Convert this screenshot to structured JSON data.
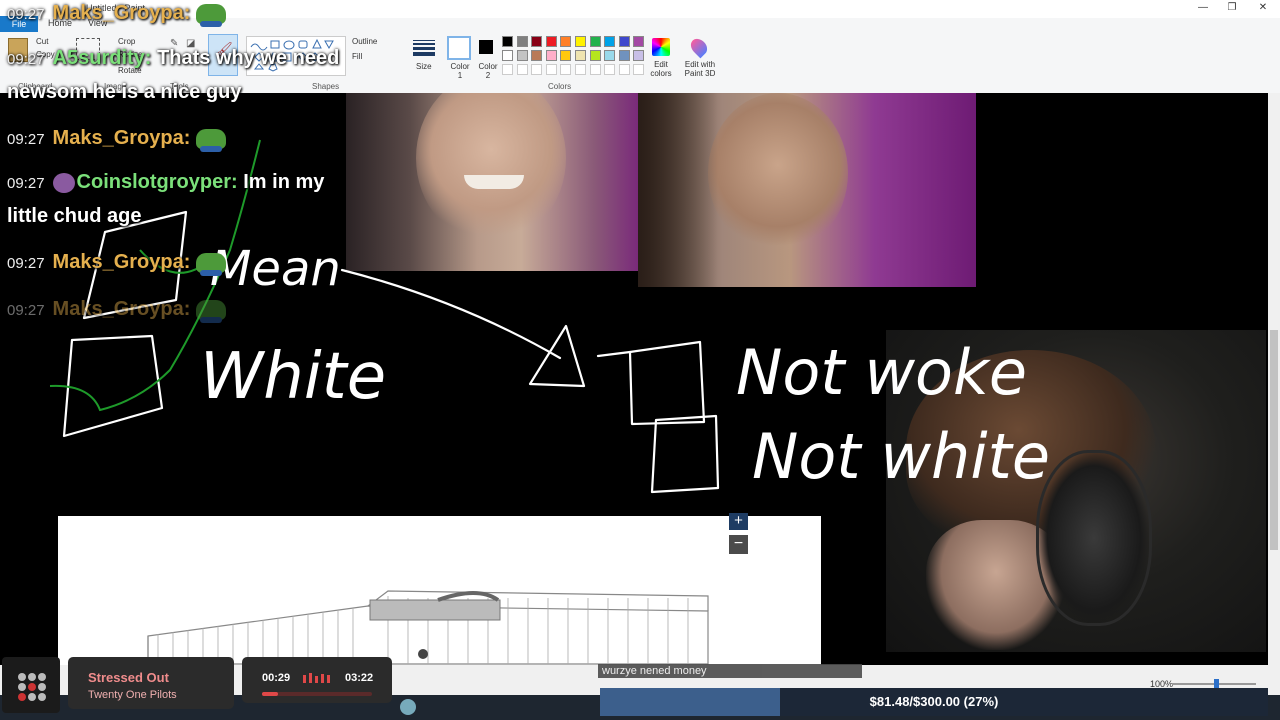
{
  "window": {
    "title": "Untitled - Paint",
    "file_tab": "File",
    "tabs": [
      "Home",
      "View"
    ],
    "controls": [
      "—",
      "❐",
      "✕"
    ]
  },
  "ribbon": {
    "clipboard": {
      "cut": "Cut",
      "copy": "Copy",
      "label": "Clipboard"
    },
    "image": {
      "crop": "Crop",
      "resize": "Resize",
      "rotate": "Rotate",
      "label": "Image"
    },
    "tools_label": "Tools",
    "shapes": {
      "outline": "Outline",
      "fill": "Fill",
      "label": "Shapes"
    },
    "size_label": "Size",
    "color1_label": "Color 1",
    "color2_label": "Color 2",
    "colors_label": "Colors",
    "edit_colors": "Edit colors",
    "edit_paint3d": "Edit with Paint 3D",
    "palette_row1": [
      "#000000",
      "#7f7f7f",
      "#880015",
      "#ed1c24",
      "#ff7f27",
      "#fff200",
      "#22b14c",
      "#00a2e8",
      "#3f48cc",
      "#a349a4"
    ],
    "palette_row2": [
      "#ffffff",
      "#c3c3c3",
      "#b97a57",
      "#ffaec9",
      "#ffc90e",
      "#efe4b0",
      "#b5e61d",
      "#99d9ea",
      "#7092be",
      "#c8bfe7"
    ]
  },
  "chat": [
    {
      "time": "09:27",
      "user": "Maks_Groypa:",
      "color": "gold",
      "text": "",
      "emote": true
    },
    {
      "time": "09:27",
      "user": "A5surdity:",
      "color": "green",
      "text": "Thats why we need",
      "text2": "newsom he is a nice guy"
    },
    {
      "time": "09:27",
      "user": "Maks_Groypa:",
      "color": "gold",
      "text": "",
      "emote": true
    },
    {
      "time": "09:27",
      "user": "Coinslotgroyper:",
      "color": "green",
      "text": "Im in my",
      "text2": "little chud age"
    },
    {
      "time": "09:27",
      "user": "Maks_Groypa:",
      "color": "gold",
      "text": "",
      "emote": true
    },
    {
      "time": "09:27",
      "user": "Maks_Groypa:",
      "color": "gold",
      "text": "",
      "emote": true
    }
  ],
  "drawing_words": [
    "Mean",
    "White",
    "Not woke",
    "Not white"
  ],
  "map": {
    "zoom_in": "+",
    "zoom_out": "−"
  },
  "music": {
    "title": "Stressed Out",
    "artist": "Twenty One Pilots",
    "current": "00:29",
    "total": "03:22",
    "progress": 0.144
  },
  "donation": {
    "message": "wurzye nened money",
    "goal_text": "$81.48/$300.00 (27%)",
    "progress": 0.27
  },
  "status": {
    "zoom": "100%"
  }
}
